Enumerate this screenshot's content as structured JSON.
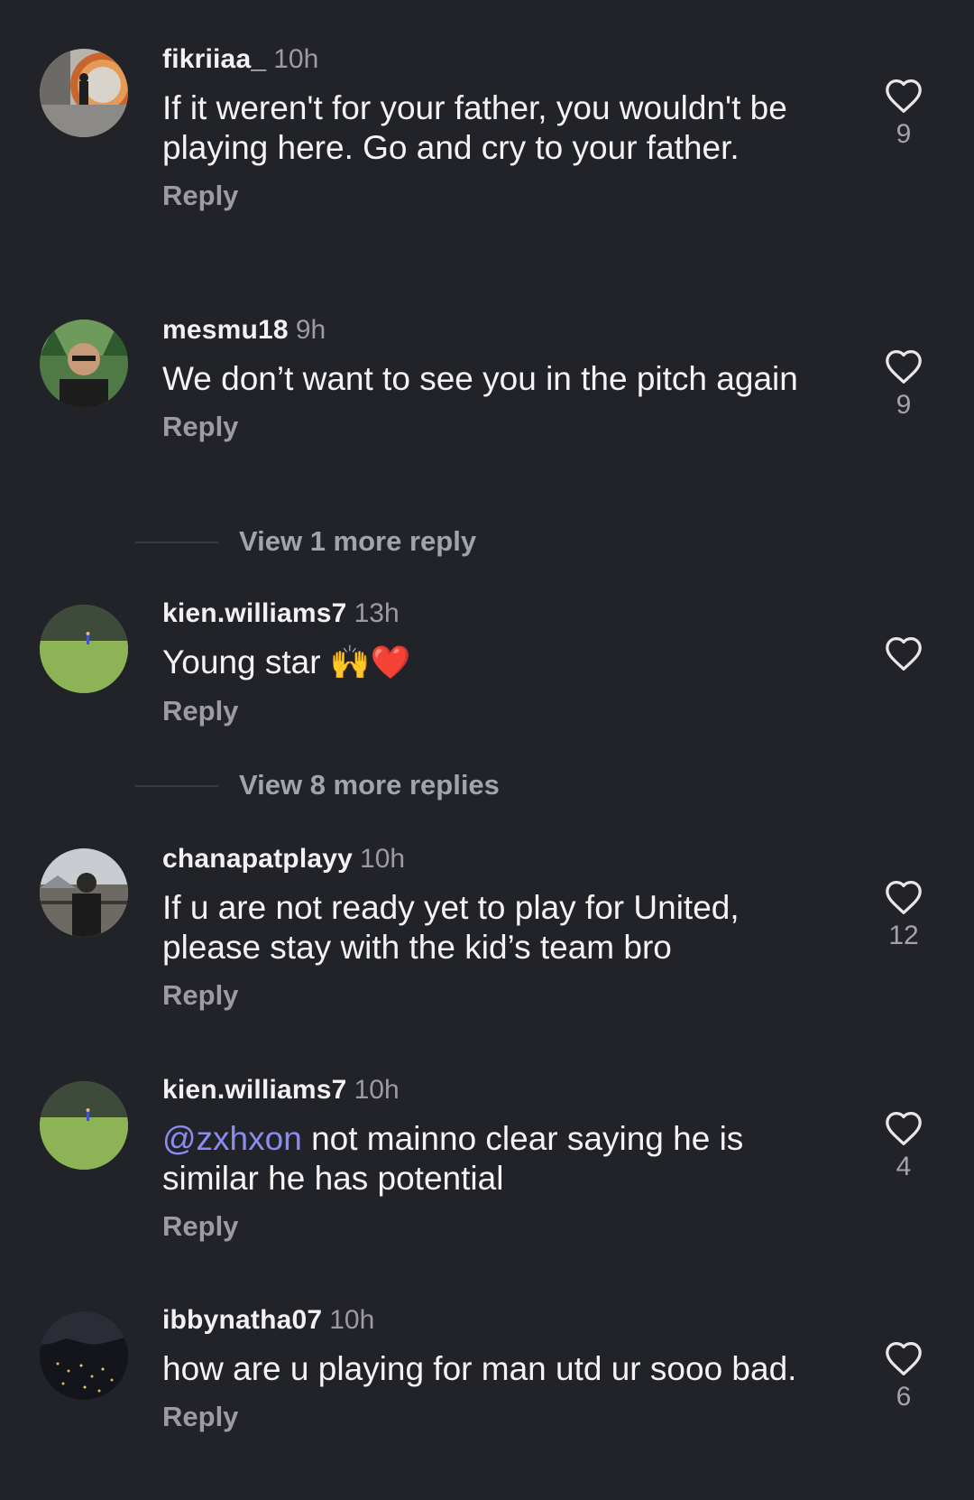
{
  "comments": [
    {
      "username": "fikriiaa_",
      "time": "10h",
      "text": "If it weren't for your father, you wouldn't be playing here. Go and cry to your father.",
      "reply_label": "Reply",
      "likes": "9"
    },
    {
      "username": "mesmu18",
      "time": "9h",
      "text": "We don’t want to see you in the pitch again",
      "reply_label": "Reply",
      "likes": "9",
      "more_replies": "View 1 more reply"
    },
    {
      "username": "kien.williams7",
      "time": "13h",
      "text": "Young star",
      "emoji": "🙌❤️",
      "reply_label": "Reply",
      "likes": "",
      "more_replies": "View 8 more replies"
    },
    {
      "username": "chanapatplayy",
      "time": "10h",
      "text": "If u are not ready yet to play for United, please stay with the kid’s team bro",
      "reply_label": "Reply",
      "likes": "12"
    },
    {
      "username": "kien.williams7",
      "time": "10h",
      "mention": "@zxhxon",
      "text": " not mainno clear saying he is similar he has potential",
      "reply_label": "Reply",
      "likes": "4"
    },
    {
      "username": "ibbynatha07",
      "time": "10h",
      "text": "how are u playing for man utd ur sooo bad.",
      "reply_label": "Reply",
      "likes": "6"
    }
  ],
  "icons": {
    "like": "heart-outline-icon"
  },
  "colors": {
    "background": "#222329",
    "mention": "#8a8cf0",
    "secondary_text": "#9b9ba1"
  }
}
